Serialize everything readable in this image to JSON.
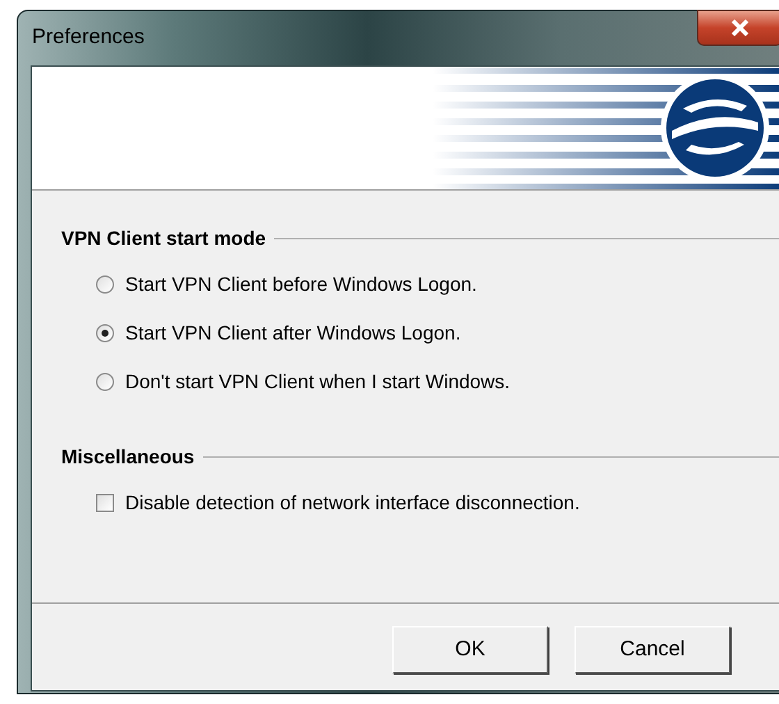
{
  "window": {
    "title": "Preferences"
  },
  "sections": [
    {
      "title": "VPN Client start mode",
      "options": [
        {
          "kind": "radio",
          "label": "Start VPN Client before Windows Logon.",
          "selected": false
        },
        {
          "kind": "radio",
          "label": "Start VPN Client after Windows Logon.",
          "selected": true
        },
        {
          "kind": "radio",
          "label": "Don't start VPN Client when I start Windows.",
          "selected": false
        }
      ]
    },
    {
      "title": "Miscellaneous",
      "options": [
        {
          "kind": "checkbox",
          "label": "Disable detection of network interface disconnection.",
          "checked": false
        }
      ]
    }
  ],
  "buttons": [
    "OK",
    "Cancel"
  ]
}
